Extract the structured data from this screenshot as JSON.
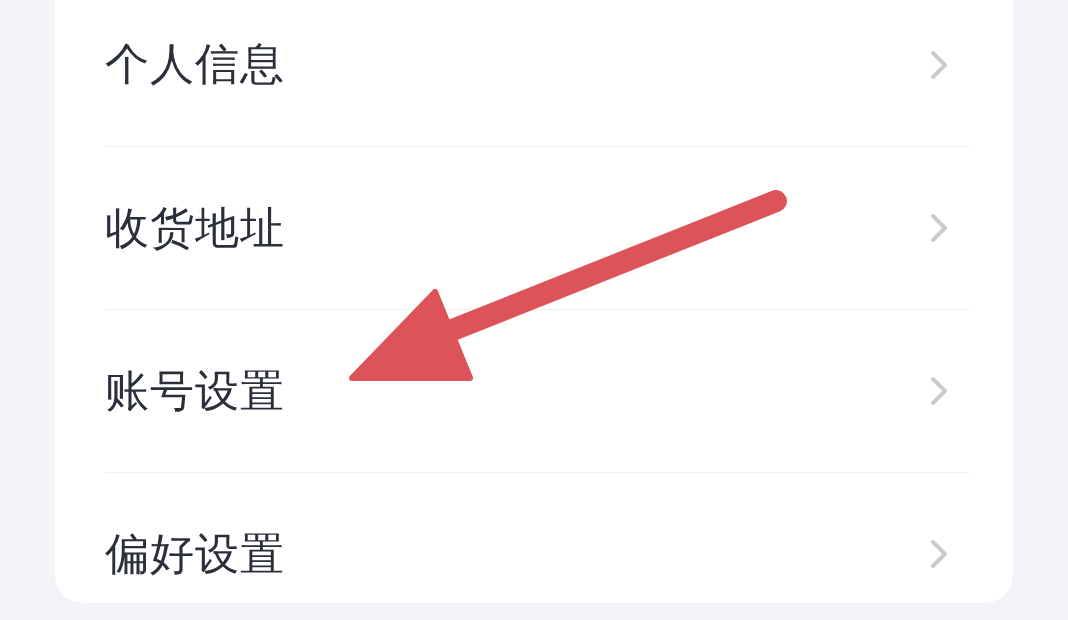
{
  "menu": {
    "items": [
      {
        "label": "个人信息"
      },
      {
        "label": "收货地址"
      },
      {
        "label": "账号设置"
      },
      {
        "label": "偏好设置"
      }
    ]
  }
}
